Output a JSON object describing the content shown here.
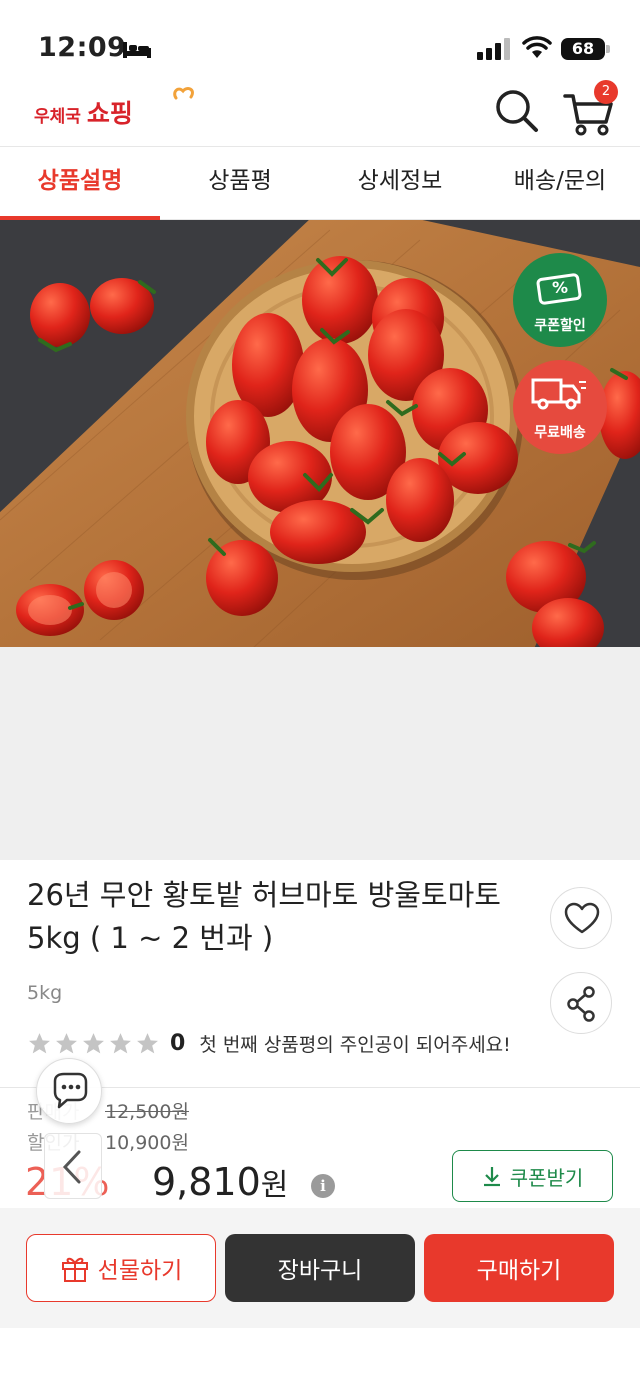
{
  "status_bar": {
    "time": "12:09",
    "battery": "68"
  },
  "header": {
    "logo_small": "우체국",
    "logo_big": "쇼핑",
    "cart_count": "2",
    "icons": [
      "search-icon",
      "cart-icon"
    ]
  },
  "tabs": [
    {
      "label": "상품설명",
      "active": true
    },
    {
      "label": "상품평",
      "active": false
    },
    {
      "label": "상세정보",
      "active": false
    },
    {
      "label": "배송/문의",
      "active": false
    }
  ],
  "badges": {
    "coupon": "쿠폰할인",
    "coupon_symbol": "%",
    "shipping": "무료배송"
  },
  "product": {
    "title": "26년 무안 황토밭 허브마토 방울토마토 5kg ( 1 ~ 2 번과 )",
    "weight": "5kg",
    "rating_count": "0",
    "rating_message": "첫 번째 상품평의 주인공이 되어주세요!",
    "star_rating": 0
  },
  "price": {
    "sale_label": "판매가",
    "sale_price": "12,500원",
    "discount_label": "할인가",
    "discount_price": "10,900원",
    "discount_rate": "21%",
    "final_price": "9,810",
    "final_unit": "원",
    "info": "i",
    "coupon_button": "쿠폰받기"
  },
  "actions": {
    "gift": "선물하기",
    "cart": "장바구니",
    "buy": "구매하기"
  },
  "colors": {
    "accent": "#e8392c",
    "green": "#1e8a4a",
    "dark": "#333333"
  }
}
